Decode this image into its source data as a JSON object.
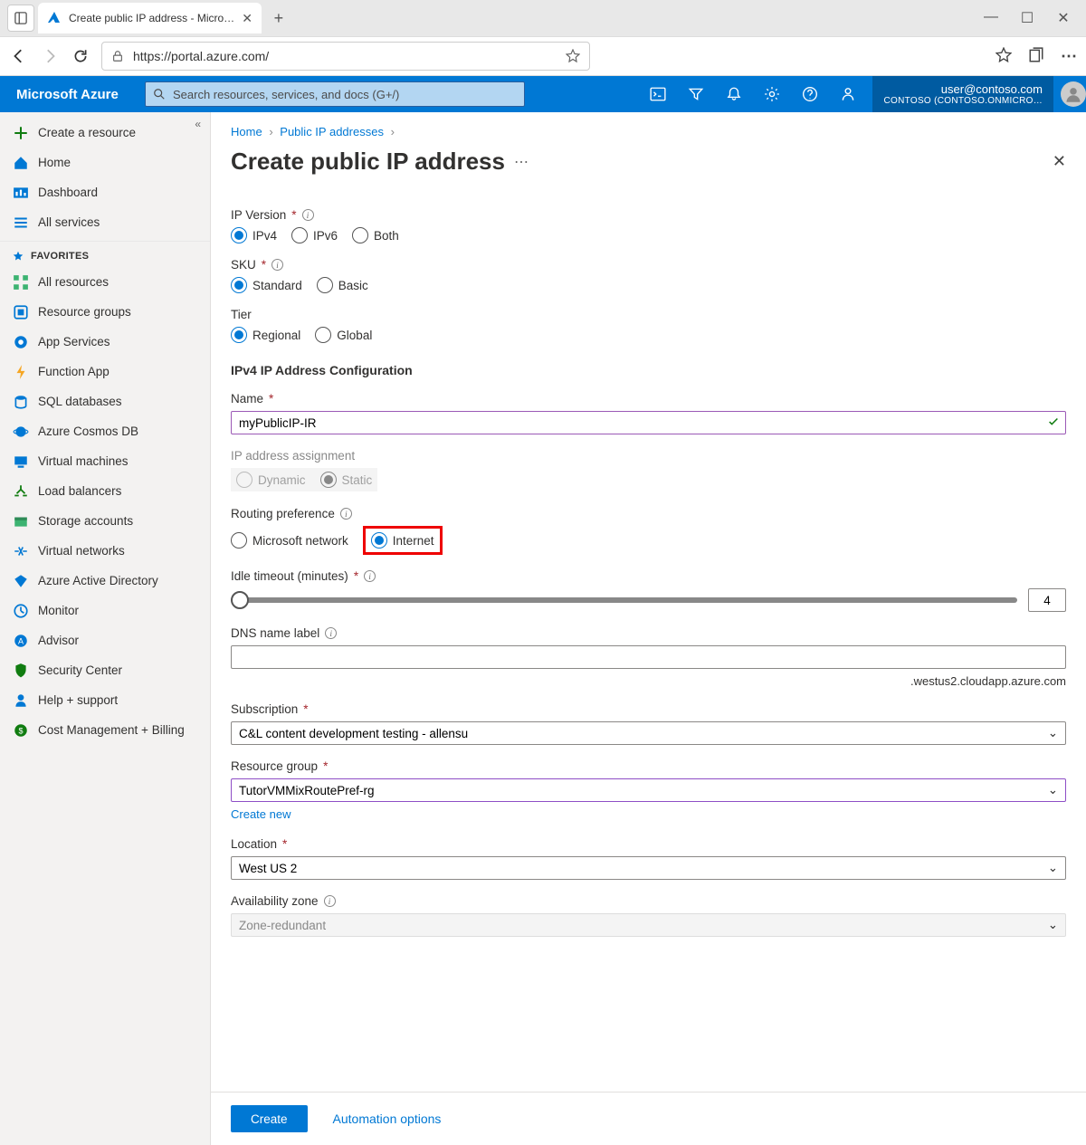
{
  "browser": {
    "tab_title": "Create public IP address - Micro…",
    "url": "https://portal.azure.com/"
  },
  "azure_header": {
    "brand": "Microsoft Azure",
    "search_placeholder": "Search resources, services, and docs (G+/)",
    "user_email": "user@contoso.com",
    "directory": "CONTOSO (CONTOSO.ONMICRO…"
  },
  "sidebar": {
    "create": "Create a resource",
    "home": "Home",
    "dashboard": "Dashboard",
    "all_services": "All services",
    "favorites_header": "FAVORITES",
    "items": [
      "All resources",
      "Resource groups",
      "App Services",
      "Function App",
      "SQL databases",
      "Azure Cosmos DB",
      "Virtual machines",
      "Load balancers",
      "Storage accounts",
      "Virtual networks",
      "Azure Active Directory",
      "Monitor",
      "Advisor",
      "Security Center",
      "Help + support",
      "Cost Management + Billing"
    ]
  },
  "breadcrumb": {
    "home": "Home",
    "parent": "Public IP addresses"
  },
  "page": {
    "title": "Create public IP address"
  },
  "form": {
    "ip_version": {
      "label": "IP Version",
      "opt1": "IPv4",
      "opt2": "IPv6",
      "opt3": "Both"
    },
    "sku": {
      "label": "SKU",
      "opt1": "Standard",
      "opt2": "Basic"
    },
    "tier": {
      "label": "Tier",
      "opt1": "Regional",
      "opt2": "Global"
    },
    "section": "IPv4 IP Address Configuration",
    "name": {
      "label": "Name",
      "value": "myPublicIP-IR"
    },
    "assignment": {
      "label": "IP address assignment",
      "opt1": "Dynamic",
      "opt2": "Static"
    },
    "routing": {
      "label": "Routing preference",
      "opt1": "Microsoft network",
      "opt2": "Internet"
    },
    "idle": {
      "label": "Idle timeout (minutes)",
      "value": "4"
    },
    "dns": {
      "label": "DNS name label",
      "suffix": ".westus2.cloudapp.azure.com"
    },
    "subscription": {
      "label": "Subscription",
      "value": "C&L content development testing - allensu"
    },
    "rg": {
      "label": "Resource group",
      "value": "TutorVMMixRoutePref-rg",
      "create_new": "Create new"
    },
    "location": {
      "label": "Location",
      "value": "West US 2"
    },
    "az": {
      "label": "Availability zone",
      "value": "Zone-redundant"
    }
  },
  "footer": {
    "create": "Create",
    "automation": "Automation options"
  }
}
